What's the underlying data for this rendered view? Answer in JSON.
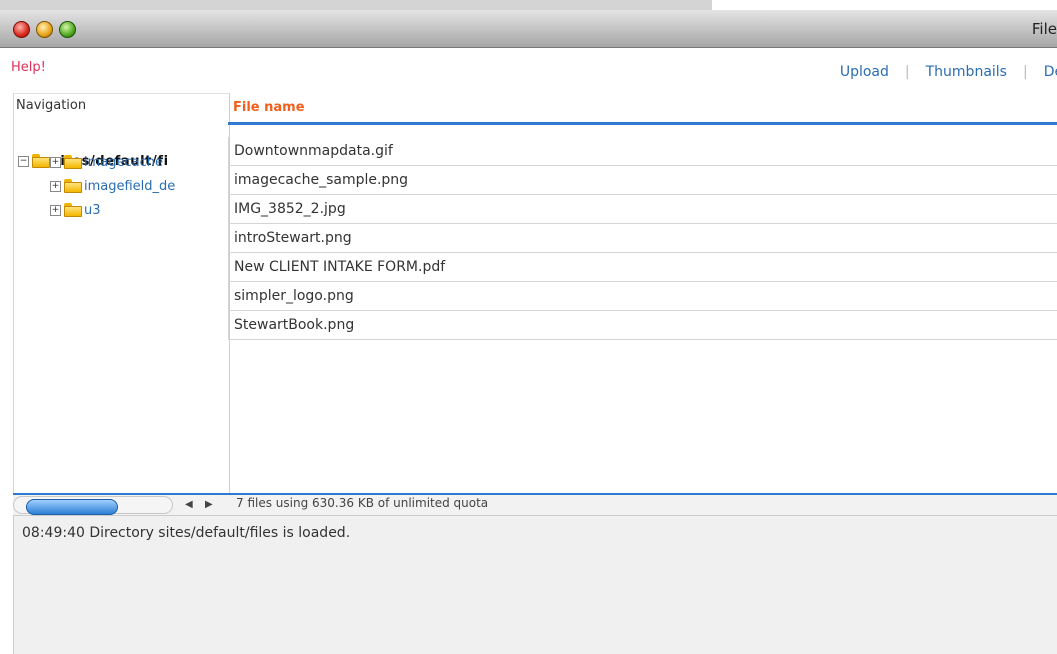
{
  "window": {
    "title": "File"
  },
  "header": {
    "help": "Help!",
    "links": [
      "Upload",
      "Thumbnails",
      "Del"
    ]
  },
  "nav": {
    "title": "Navigation",
    "root": "sites/default/fi",
    "children": [
      "imagecache",
      "imagefield_de",
      "u3"
    ]
  },
  "files": {
    "column_header": "File name",
    "rows": [
      "Downtownmapdata.gif",
      "imagecache_sample.png",
      "IMG_3852_2.jpg",
      "introStewart.png",
      "New CLIENT INTAKE FORM.pdf",
      "simpler_logo.png",
      "StewartBook.png"
    ]
  },
  "status": {
    "text": "7 files using 630.36 KB of unlimited quota"
  },
  "log": {
    "line": "08:49:40 Directory sites/default/files is loaded."
  },
  "colors": {
    "accent": "#2f7ad1",
    "header_orange": "#f0601c",
    "help_red": "#e0305a",
    "link_blue": "#2a6db0"
  }
}
